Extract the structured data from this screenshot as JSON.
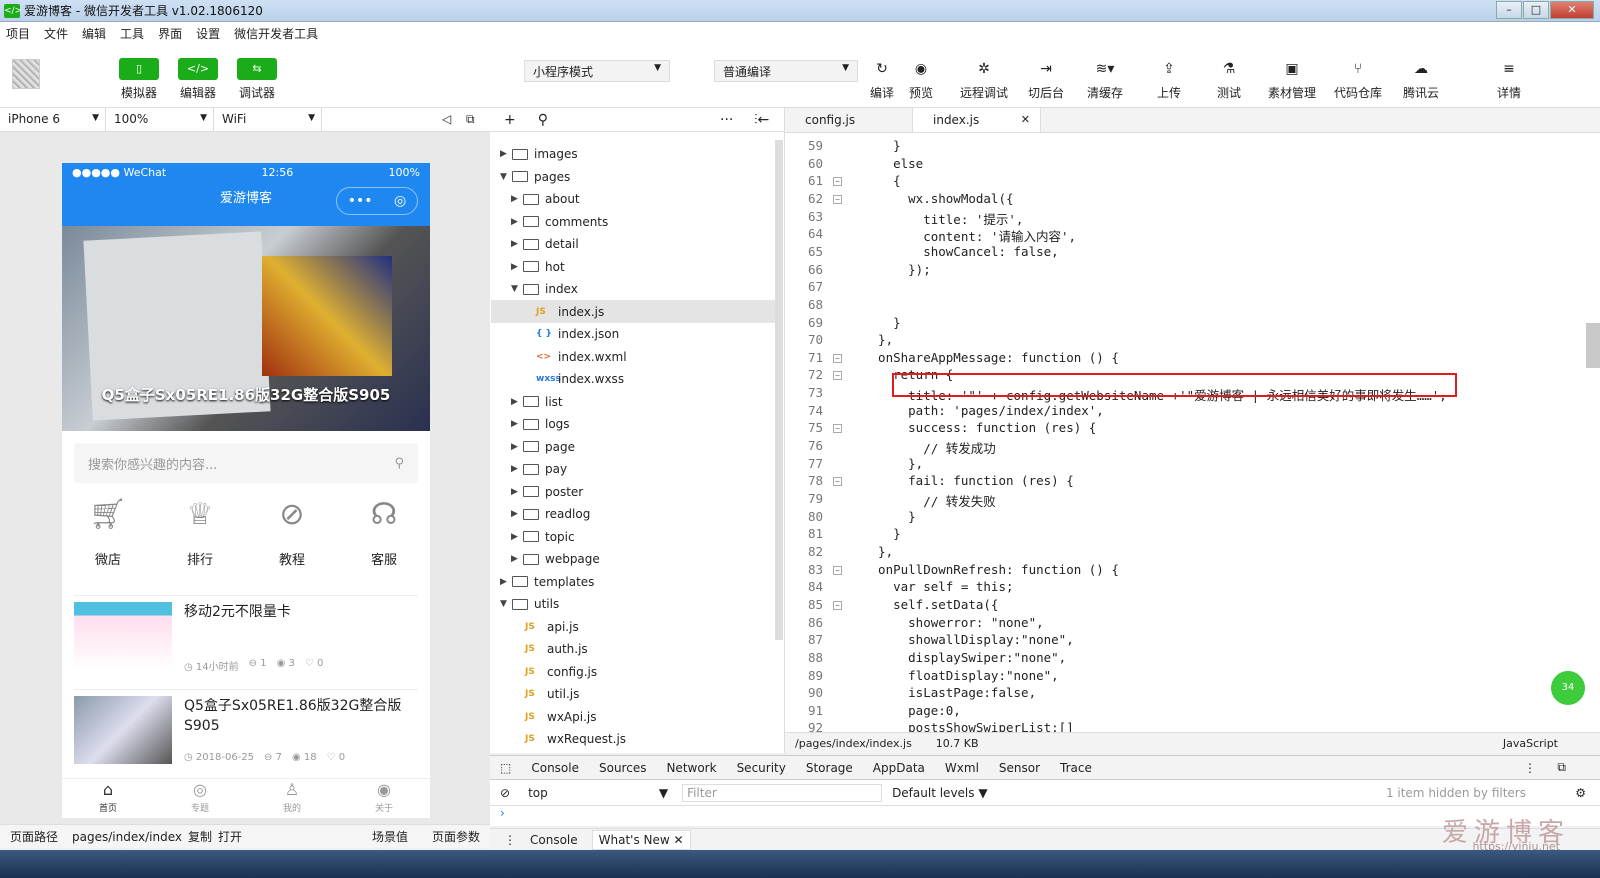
{
  "window": {
    "title": "爱游博客 - 微信开发者工具 v1.02.1806120"
  },
  "menu": [
    "项目",
    "文件",
    "编辑",
    "工具",
    "界面",
    "设置",
    "微信开发者工具"
  ],
  "toolbar": {
    "simulator": "模拟器",
    "editor": "编辑器",
    "debugger": "调试器",
    "mode_select": "小程序模式",
    "compile_select": "普通编译",
    "tools": [
      "编译",
      "预览",
      "远程调试",
      "切后台",
      "清缓存",
      "上传",
      "测试",
      "素材管理",
      "代码仓库",
      "腾讯云",
      "详情"
    ]
  },
  "device": {
    "model": "iPhone 6",
    "zoom": "100%",
    "network": "WiFi"
  },
  "phone": {
    "carrier": "●●●●● WeChat",
    "time": "12:56",
    "battery": "100%",
    "nav_title": "爱游博客",
    "banner_caption": "Q5盒子Sx05RE1.86版32G整合版S905",
    "search_placeholder": "搜索你感兴趣的内容...",
    "categories": [
      "微店",
      "排行",
      "教程",
      "客服"
    ],
    "articles": [
      {
        "title": "移动2元不限量卡",
        "time": "14小时前",
        "comments": "1",
        "views": "3",
        "likes": "0"
      },
      {
        "title": "Q5盒子Sx05RE1.86版32G整合版S905",
        "time": "2018-06-25",
        "comments": "7",
        "views": "18",
        "likes": "0"
      }
    ],
    "tabs": [
      "首页",
      "专题",
      "我的",
      "关于"
    ]
  },
  "sim_footer": {
    "path_label": "页面路径",
    "path": "pages/index/index",
    "copy": "复制",
    "open": "打开",
    "scene": "场景值",
    "params": "页面参数"
  },
  "filetree": [
    {
      "name": "images",
      "type": "folder",
      "open": false,
      "depth": 0
    },
    {
      "name": "pages",
      "type": "folder",
      "open": true,
      "depth": 0
    },
    {
      "name": "about",
      "type": "folder",
      "open": false,
      "depth": 1
    },
    {
      "name": "comments",
      "type": "folder",
      "open": false,
      "depth": 1
    },
    {
      "name": "detail",
      "type": "folder",
      "open": false,
      "depth": 1
    },
    {
      "name": "hot",
      "type": "folder",
      "open": false,
      "depth": 1
    },
    {
      "name": "index",
      "type": "folder",
      "open": true,
      "depth": 1
    },
    {
      "name": "index.js",
      "type": "js",
      "depth": 2
    },
    {
      "name": "index.json",
      "type": "json",
      "depth": 2
    },
    {
      "name": "index.wxml",
      "type": "wxml",
      "depth": 2
    },
    {
      "name": "index.wxss",
      "type": "wxss",
      "depth": 2
    },
    {
      "name": "list",
      "type": "folder",
      "open": false,
      "depth": 1
    },
    {
      "name": "logs",
      "type": "folder",
      "open": false,
      "depth": 1
    },
    {
      "name": "page",
      "type": "folder",
      "open": false,
      "depth": 1
    },
    {
      "name": "pay",
      "type": "folder",
      "open": false,
      "depth": 1
    },
    {
      "name": "poster",
      "type": "folder",
      "open": false,
      "depth": 1
    },
    {
      "name": "readlog",
      "type": "folder",
      "open": false,
      "depth": 1
    },
    {
      "name": "topic",
      "type": "folder",
      "open": false,
      "depth": 1
    },
    {
      "name": "webpage",
      "type": "folder",
      "open": false,
      "depth": 1
    },
    {
      "name": "templates",
      "type": "folder",
      "open": false,
      "depth": 0
    },
    {
      "name": "utils",
      "type": "folder",
      "open": true,
      "depth": 0
    },
    {
      "name": "api.js",
      "type": "js",
      "depth": 1
    },
    {
      "name": "auth.js",
      "type": "js",
      "depth": 1
    },
    {
      "name": "config.js",
      "type": "js",
      "depth": 1
    },
    {
      "name": "util.js",
      "type": "js",
      "depth": 1
    },
    {
      "name": "wxApi.js",
      "type": "js",
      "depth": 1
    },
    {
      "name": "wxRequest.js",
      "type": "js",
      "depth": 1
    }
  ],
  "editor_tabs": [
    {
      "name": "config.js",
      "active": false
    },
    {
      "name": "index.js",
      "active": true
    }
  ],
  "code": [
    {
      "n": "59",
      "t": "    }",
      "f": ""
    },
    {
      "n": "60",
      "t": "    else",
      "f": ""
    },
    {
      "n": "61",
      "t": "    {",
      "f": "-"
    },
    {
      "n": "62",
      "t": "      wx.showModal({",
      "f": "-"
    },
    {
      "n": "63",
      "t": "        title: '提示',",
      "f": ""
    },
    {
      "n": "64",
      "t": "        content: '请输入内容',",
      "f": ""
    },
    {
      "n": "65",
      "t": "        showCancel: false,",
      "f": ""
    },
    {
      "n": "66",
      "t": "      });",
      "f": ""
    },
    {
      "n": "67",
      "t": "",
      "f": ""
    },
    {
      "n": "68",
      "t": "",
      "f": ""
    },
    {
      "n": "69",
      "t": "    }",
      "f": ""
    },
    {
      "n": "70",
      "t": "  },",
      "f": ""
    },
    {
      "n": "71",
      "t": "  onShareAppMessage: function () {",
      "f": "-"
    },
    {
      "n": "72",
      "t": "    return {",
      "f": "-"
    },
    {
      "n": "73",
      "t": "      title: '\"' + config.getWebsiteName +'\"爱游博客 | 永远相信美好的事即将发生……',",
      "f": ""
    },
    {
      "n": "74",
      "t": "      path: 'pages/index/index',",
      "f": ""
    },
    {
      "n": "75",
      "t": "      success: function (res) {",
      "f": "-"
    },
    {
      "n": "76",
      "t": "        // 转发成功",
      "f": ""
    },
    {
      "n": "77",
      "t": "      },",
      "f": ""
    },
    {
      "n": "78",
      "t": "      fail: function (res) {",
      "f": "-"
    },
    {
      "n": "79",
      "t": "        // 转发失败",
      "f": ""
    },
    {
      "n": "80",
      "t": "      }",
      "f": ""
    },
    {
      "n": "81",
      "t": "    }",
      "f": ""
    },
    {
      "n": "82",
      "t": "  },",
      "f": ""
    },
    {
      "n": "83",
      "t": "  onPullDownRefresh: function () {",
      "f": "-"
    },
    {
      "n": "84",
      "t": "    var self = this;",
      "f": ""
    },
    {
      "n": "85",
      "t": "    self.setData({",
      "f": "-"
    },
    {
      "n": "86",
      "t": "      showerror: \"none\",",
      "f": ""
    },
    {
      "n": "87",
      "t": "      showallDisplay:\"none\",",
      "f": ""
    },
    {
      "n": "88",
      "t": "      displaySwiper:\"none\",",
      "f": ""
    },
    {
      "n": "89",
      "t": "      floatDisplay:\"none\",",
      "f": ""
    },
    {
      "n": "90",
      "t": "      isLastPage:false,",
      "f": ""
    },
    {
      "n": "91",
      "t": "      page:0,",
      "f": ""
    },
    {
      "n": "92",
      "t": "      postsShowSwiperList:[]",
      "f": ""
    }
  ],
  "editor_status": {
    "path": "/pages/index/index.js",
    "size": "10.7 KB",
    "lang": "JavaScript"
  },
  "devtools": {
    "tabs": [
      "Console",
      "Sources",
      "Network",
      "Security",
      "Storage",
      "AppData",
      "Wxml",
      "Sensor",
      "Trace"
    ],
    "context": "top",
    "filter_placeholder": "Filter",
    "levels": "Default levels",
    "hidden": "1 item hidden by filters",
    "bottom_tabs": [
      "Console",
      "What's New"
    ]
  },
  "watermark": {
    "text": "爱游博客",
    "url": "https://yiniu.net"
  },
  "badge": "34"
}
